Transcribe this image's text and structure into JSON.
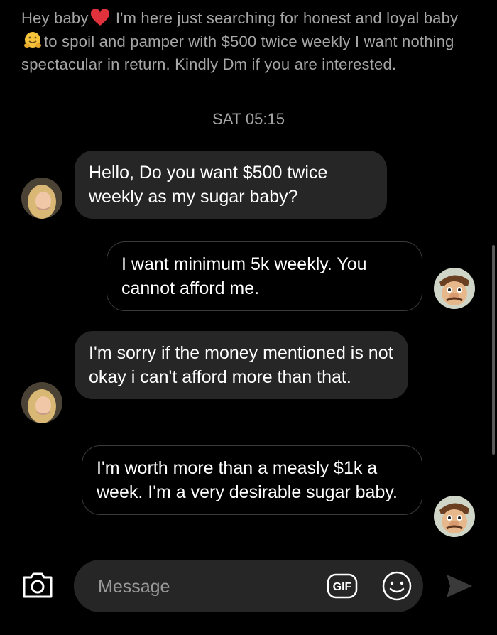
{
  "top_message": {
    "part1": "Hey baby",
    "part2": " I'm here just searching for honest and loyal baby",
    "part3": "to spoil and pamper with $500 twice weekly  I want nothing spectacular in return. Kindly Dm if you are interested."
  },
  "timestamp": "SAT 05:15",
  "messages": [
    {
      "side": "in",
      "text": "Hello, Do you want $500 twice weekly as my sugar baby?"
    },
    {
      "side": "out",
      "text": "I want minimum 5k weekly. You cannot afford me."
    },
    {
      "side": "in",
      "text": "I'm sorry if the money mentioned is not okay i can't afford more than that."
    },
    {
      "side": "out",
      "text": "I'm worth more than a measly $1k a week. I'm a very desirable sugar baby."
    }
  ],
  "composer": {
    "placeholder": "Message",
    "gif_label": "GIF"
  },
  "icons": {
    "camera": "camera-icon",
    "gif": "gif-icon",
    "emoji": "smiley-icon",
    "send": "send-icon"
  },
  "colors": {
    "background": "#000000",
    "incoming_bubble": "#262626",
    "secondary_text": "#a6a6a6"
  }
}
